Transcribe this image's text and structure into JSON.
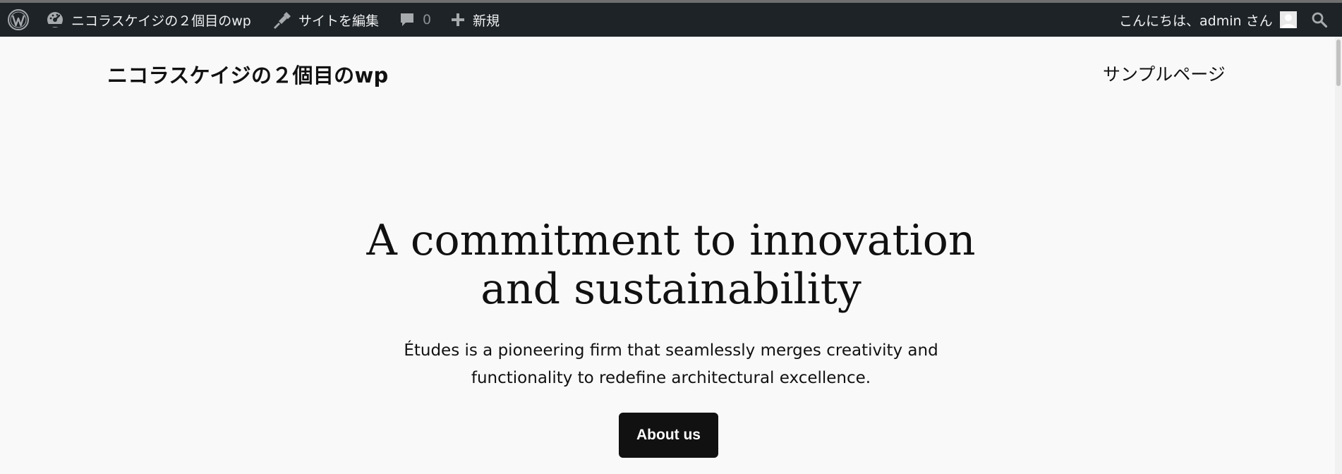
{
  "admin_bar": {
    "site_name": "ニコラスケイジの２個目のwp",
    "edit_site_label": "サイトを編集",
    "comments_count": "0",
    "new_label": "新規",
    "greeting": "こんにちは、admin さん",
    "icons": {
      "wordpress": "wordpress-logo-icon",
      "dashboard": "dashboard-icon",
      "edit": "brush-icon",
      "comments": "comment-icon",
      "new": "plus-icon",
      "avatar": "user-avatar-icon",
      "search": "search-icon"
    },
    "colors": {
      "background": "#1d2327",
      "text": "#f0f0f1",
      "muted": "#8c8f94"
    }
  },
  "header": {
    "site_title": "ニコラスケイジの２個目のwp",
    "nav": [
      {
        "label": "サンプルページ"
      }
    ]
  },
  "hero": {
    "heading_line1": "A commitment to innovation",
    "heading_line2": "and sustainability",
    "body_line1": "Études is a pioneering firm that seamlessly merges creativity and",
    "body_line2": "functionality to redefine architectural excellence.",
    "button_label": "About us"
  },
  "colors": {
    "page_background": "#f9f9f9",
    "text": "#111111",
    "button_background": "#111111",
    "button_text": "#ffffff"
  }
}
